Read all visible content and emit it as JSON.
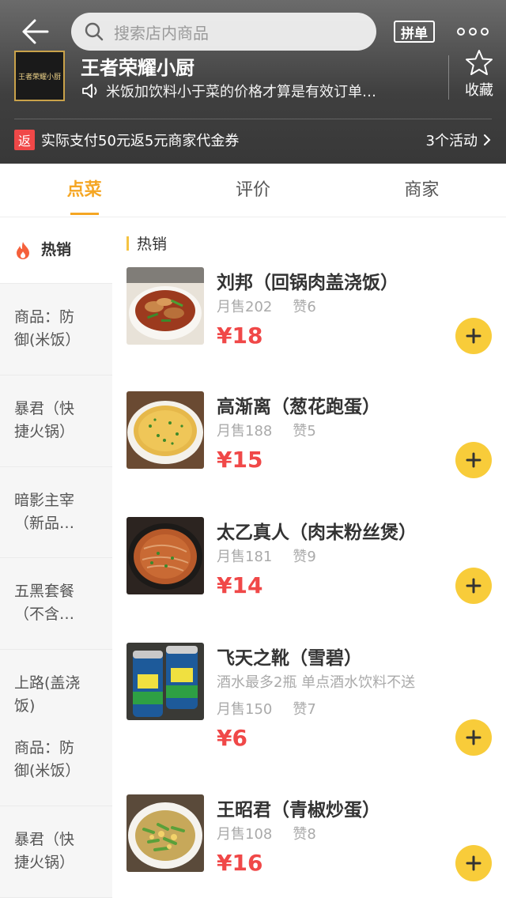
{
  "header": {
    "search_placeholder": "搜索店内商品",
    "pin_label": "拼单",
    "shop_name": "王者荣耀小厨",
    "logo_text": "王者荣耀小厨",
    "notice": "米饭加饮料小于菜的价格才算是有效订单…",
    "fav_label": "收藏",
    "promo_badge": "返",
    "promo_text": "实际支付50元返5元商家代金券",
    "activities": "3个活动"
  },
  "tabs": [
    {
      "label": "点菜",
      "active": true
    },
    {
      "label": "评价",
      "active": false
    },
    {
      "label": "商家",
      "active": false
    }
  ],
  "sidebar": {
    "active_label": "热销",
    "items": [
      {
        "lines": [
          "商品：防",
          "御(米饭）"
        ]
      },
      {
        "lines": [
          "暴君（快",
          "捷火锅）"
        ]
      },
      {
        "lines": [
          "暗影主宰",
          "（新品…"
        ]
      },
      {
        "lines": [
          "五黑套餐",
          "（不含…"
        ]
      },
      {
        "lines": [
          "上路(盖浇",
          "饭)",
          "",
          "商品：防",
          "御(米饭）"
        ]
      },
      {
        "lines": [
          "暴君（快",
          "捷火锅）"
        ]
      }
    ]
  },
  "section_title": "热销",
  "products": [
    {
      "name": "刘邦（回锅肉盖浇饭）",
      "note": "",
      "sales": "月售202",
      "likes": "赞6",
      "price": "¥18",
      "image": "stir-fry-pork-rice"
    },
    {
      "name": "高渐离（葱花跑蛋）",
      "note": "",
      "sales": "月售188",
      "likes": "赞5",
      "price": "¥15",
      "image": "scallion-omelette"
    },
    {
      "name": "太乙真人（肉末粉丝煲）",
      "note": "",
      "sales": "月售181",
      "likes": "赞9",
      "price": "¥14",
      "image": "vermicelli-pot"
    },
    {
      "name": "飞天之靴（雪碧）",
      "note": "酒水最多2瓶  单点酒水饮料不送",
      "sales": "月售150",
      "likes": "赞7",
      "price": "¥6",
      "image": "sprite-cans"
    },
    {
      "name": "王昭君（青椒炒蛋）",
      "note": "",
      "sales": "月售108",
      "likes": "赞8",
      "price": "¥16",
      "image": "pepper-egg"
    }
  ]
}
